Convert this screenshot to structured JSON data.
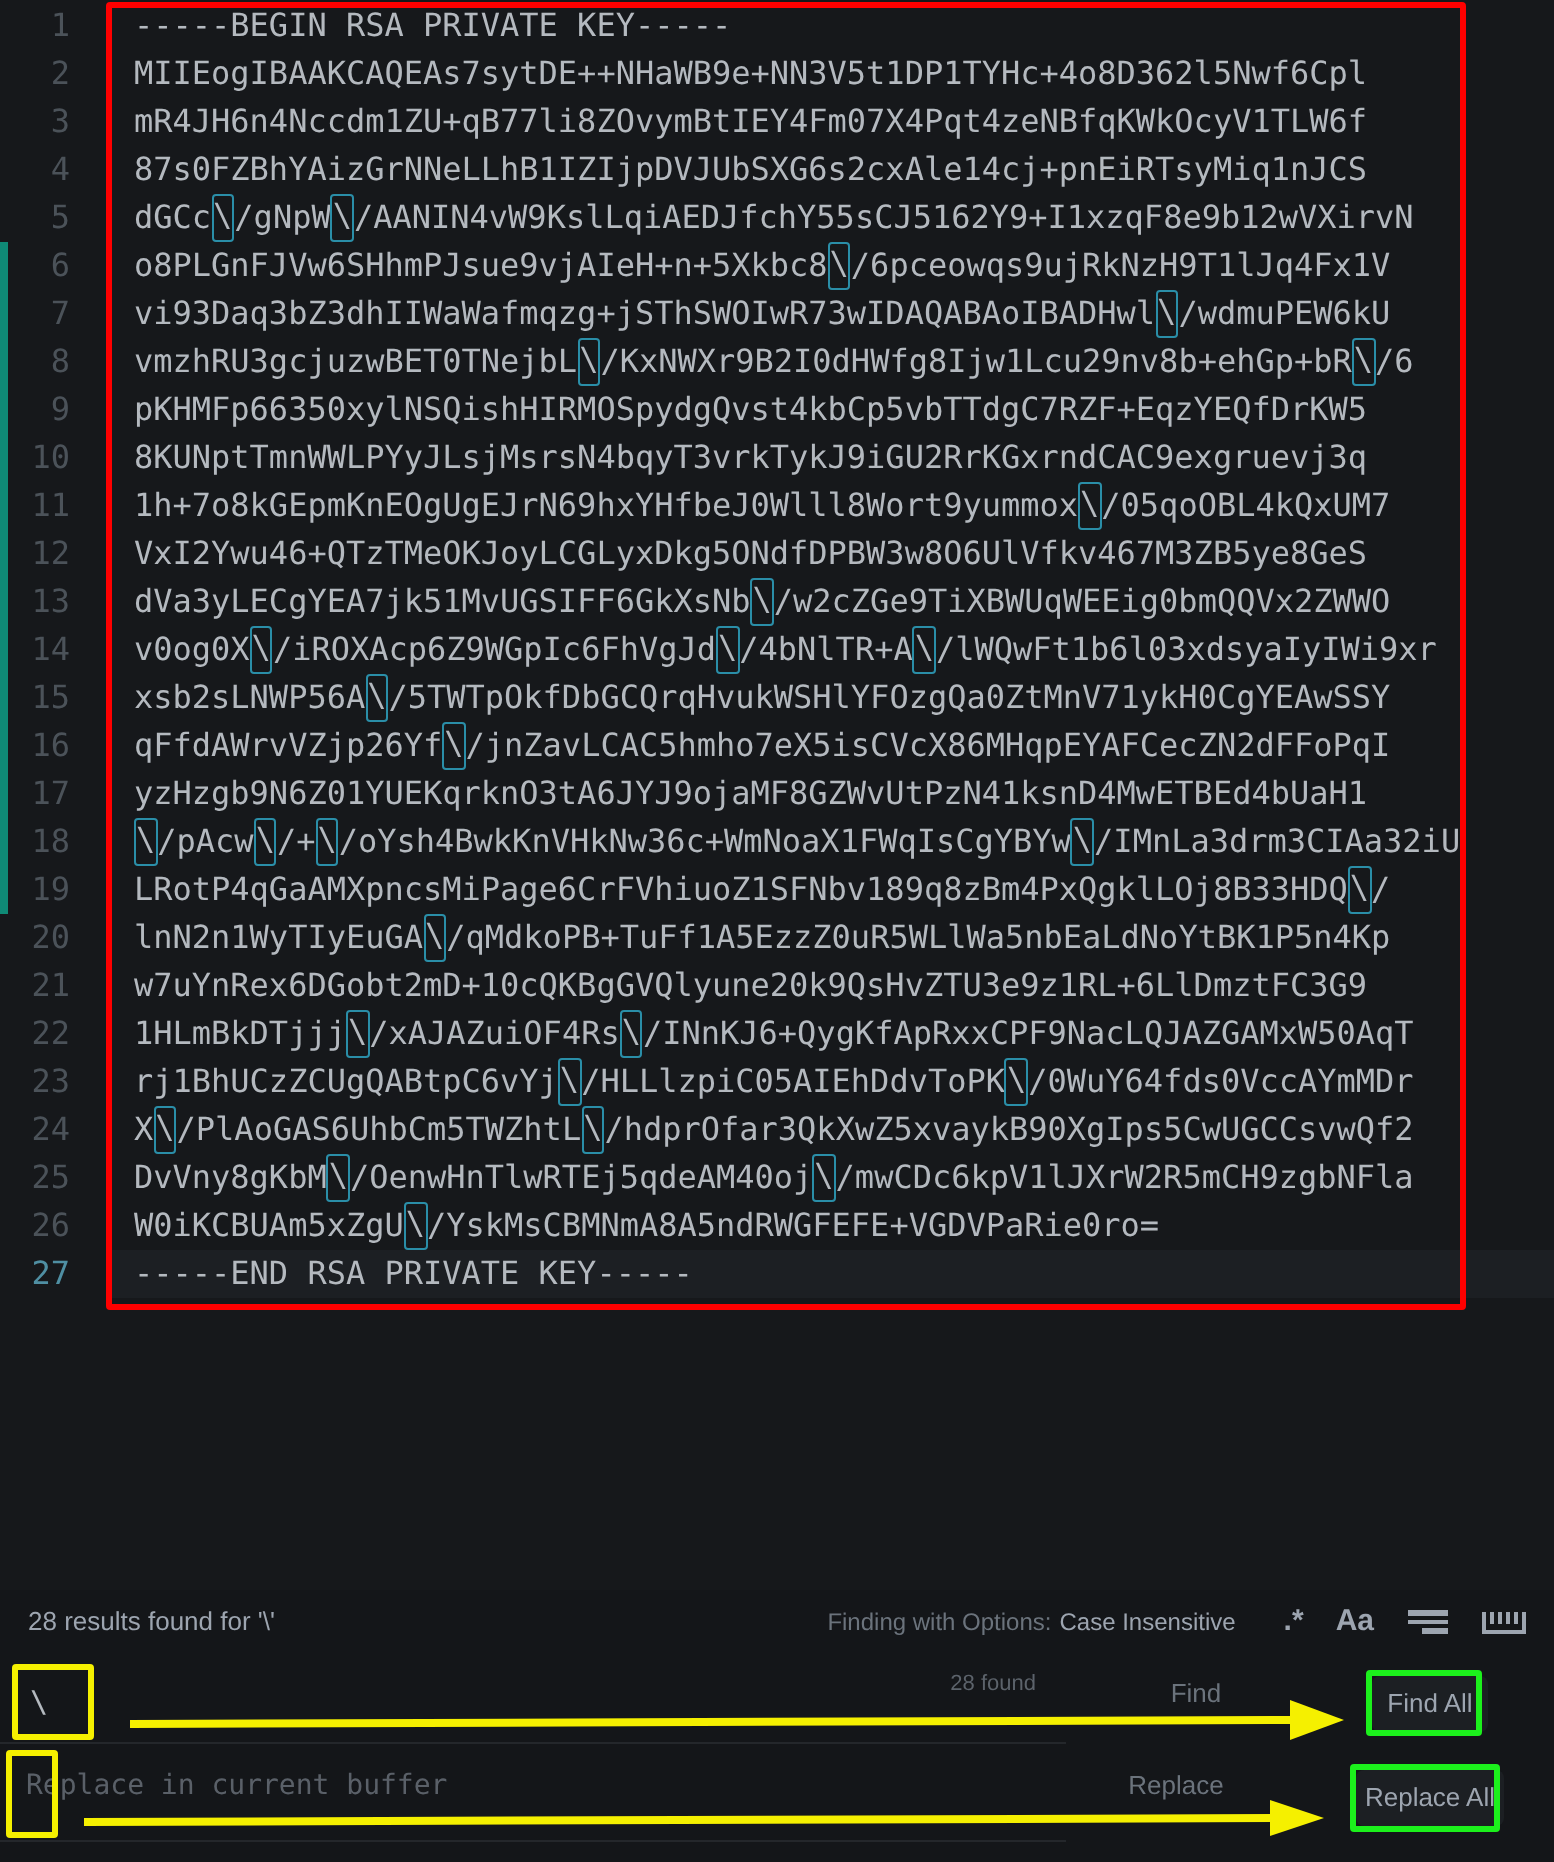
{
  "editor": {
    "lines": [
      {
        "number": "1",
        "text": "-----BEGIN RSA PRIVATE KEY-----",
        "modified": false,
        "cursor": false
      },
      {
        "number": "2",
        "text": "MIIEogIBAAKCAQEAs7sytDE++NHaWB9e+NN3V5t1DP1TYHc+4o8D362l5Nwf6Cpl",
        "modified": false,
        "cursor": false
      },
      {
        "number": "3",
        "text": "mR4JH6n4Nccdm1ZU+qB77li8ZOvymBtIEY4Fm07X4Pqt4zeNBfqKWkOcyV1TLW6f",
        "modified": false,
        "cursor": false
      },
      {
        "number": "4",
        "text": "87s0FZBhYAizGrNNeLLhB1IZIjpDVJUbSXG6s2cxAle14cj+pnEiRTsyMiq1nJCS",
        "modified": false,
        "cursor": false
      },
      {
        "number": "5",
        "text": "dGCc\\/gNpW\\/AANIN4vW9KslLqiAEDJfchY55sCJ5162Y9+I1xzqF8e9b12wVXirvN",
        "modified": false,
        "cursor": false
      },
      {
        "number": "6",
        "text": "o8PLGnFJVw6SHhmPJsue9vjAIeH+n+5Xkbc8\\/6pceowqs9ujRkNzH9T1lJq4Fx1V",
        "modified": true,
        "cursor": false
      },
      {
        "number": "7",
        "text": "vi93Daq3bZ3dhIIWaWafmqzg+jSThSWOIwR73wIDAQABAoIBADHwl\\/wdmuPEW6kU",
        "modified": true,
        "cursor": false
      },
      {
        "number": "8",
        "text": "vmzhRU3gcjuzwBET0TNejbL\\/KxNWXr9B2I0dHWfg8Ijw1Lcu29nv8b+ehGp+bR\\/6",
        "modified": true,
        "cursor": false
      },
      {
        "number": "9",
        "text": "pKHMFp66350xylNSQishHIRMOSpydgQvst4kbCp5vbTTdgC7RZF+EqzYEQfDrKW5",
        "modified": true,
        "cursor": false
      },
      {
        "number": "10",
        "text": "8KUNptTmnWWLPYyJLsjMsrsN4bqyT3vrkTykJ9iGU2RrKGxrndCAC9exgruevj3q",
        "modified": true,
        "cursor": false
      },
      {
        "number": "11",
        "text": "1h+7o8kGEpmKnEOgUgEJrN69hxYHfbeJ0Wlll8Wort9yummox\\/05qoOBL4kQxUM7",
        "modified": true,
        "cursor": false
      },
      {
        "number": "12",
        "text": "VxI2Ywu46+QTzTMeOKJoyLCGLyxDkg5ONdfDPBW3w8O6UlVfkv467M3ZB5ye8GeS",
        "modified": true,
        "cursor": false
      },
      {
        "number": "13",
        "text": "dVa3yLECgYEA7jk51MvUGSIFF6GkXsNb\\/w2cZGe9TiXBWUqWEEig0bmQQVx2ZWWO",
        "modified": true,
        "cursor": false
      },
      {
        "number": "14",
        "text": "v0og0X\\/iROXAcp6Z9WGpIc6FhVgJd\\/4bNlTR+A\\/lWQwFt1b6l03xdsyaIyIWi9xr",
        "modified": true,
        "cursor": false
      },
      {
        "number": "15",
        "text": "xsb2sLNWP56A\\/5TWTpOkfDbGCQrqHvukWSHlYFOzgQa0ZtMnV71ykH0CgYEAwSSY",
        "modified": true,
        "cursor": false
      },
      {
        "number": "16",
        "text": "qFfdAWrvVZjp26Yf\\/jnZavLCAC5hmho7eX5isCVcX86MHqpEYAFCecZN2dFFoPqI",
        "modified": true,
        "cursor": false
      },
      {
        "number": "17",
        "text": "yzHzgb9N6Z01YUEKqrknO3tA6JYJ9ojaMF8GZWvUtPzN41ksnD4MwETBEd4bUaH1",
        "modified": true,
        "cursor": false
      },
      {
        "number": "18",
        "text": "\\/pAcw\\/+\\/oYsh4BwkKnVHkNw36c+WmNoaX1FWqIsCgYBYw\\/IMnLa3drm3CIAa32iU",
        "modified": true,
        "cursor": false
      },
      {
        "number": "19",
        "text": "LRotP4qGaAMXpncsMiPage6CrFVhiuoZ1SFNbv189q8zBm4PxQgklLOj8B33HDQ\\/",
        "modified": true,
        "cursor": false
      },
      {
        "number": "20",
        "text": "lnN2n1WyTIyEuGA\\/qMdkoPB+TuFf1A5EzzZ0uR5WLlWa5nbEaLdNoYtBK1P5n4Kp",
        "modified": false,
        "cursor": false
      },
      {
        "number": "21",
        "text": "w7uYnRex6DGobt2mD+10cQKBgGVQlyune20k9QsHvZTU3e9z1RL+6LlDmztFC3G9",
        "modified": false,
        "cursor": false
      },
      {
        "number": "22",
        "text": "1HLmBkDTjjj\\/xAJAZuiOF4Rs\\/INnKJ6+QygKfApRxxCPF9NacLQJAZGAMxW50AqT",
        "modified": false,
        "cursor": false
      },
      {
        "number": "23",
        "text": "rj1BhUCzZCUgQABtpC6vYj\\/HLLlzpiC05AIEhDdvToPK\\/0WuY64fds0VccAYmMDr",
        "modified": false,
        "cursor": false
      },
      {
        "number": "24",
        "text": "X\\/PlAoGAS6UhbCm5TWZhtL\\/hdprOfar3QkXwZ5xvaykB90XgIps5CwUGCCsvwQf2",
        "modified": false,
        "cursor": false
      },
      {
        "number": "25",
        "text": "DvVny8gKbM\\/OenwHnTlwRTEj5qdeAM40oj\\/mwCDc6kpV1lJXrW2R5mCH9zgbNFla",
        "modified": false,
        "cursor": false
      },
      {
        "number": "26",
        "text": "W0iKCBUAm5xZgU\\/YskMsCBMNmA8A5ndRWGFEFE+VGDVPaRie0ro=",
        "modified": false,
        "cursor": false
      },
      {
        "number": "27",
        "text": "-----END RSA PRIVATE KEY-----",
        "modified": false,
        "cursor": true
      }
    ]
  },
  "find_panel": {
    "status": "28 results found for '\\'",
    "options_label": "Finding with Options:",
    "options_value": "Case Insensitive",
    "option_toggles": [
      ".*",
      "Aa"
    ],
    "find": {
      "value": "\\",
      "count": "28 found",
      "label": "Find",
      "button": "Find All"
    },
    "replace": {
      "placeholder": "Replace in current buffer",
      "label": "Replace",
      "button": "Replace All"
    }
  }
}
